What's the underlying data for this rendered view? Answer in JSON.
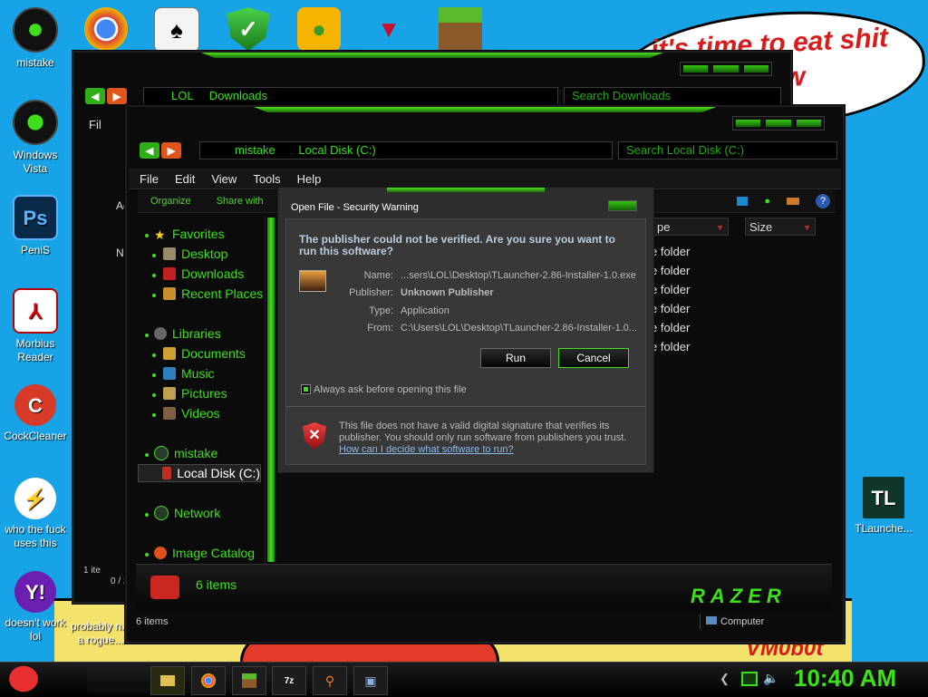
{
  "wallpaper": {
    "bubble_text": "it's time to eat shit chew",
    "signature": "VM0b0t"
  },
  "desktop_icons": [
    {
      "label": "mistake",
      "icon": "user-folder-icon"
    },
    {
      "label": "Windows Vista",
      "icon": "recycle-bin-icon"
    },
    {
      "label": "PeniS",
      "icon": "photoshop-icon",
      "glyph": "Ps"
    },
    {
      "label": "Morbius Reader",
      "icon": "pdf-reader-icon"
    },
    {
      "label": "CockCleaner",
      "icon": "ccleaner-icon",
      "glyph": "C"
    },
    {
      "label": "who the fuck uses this",
      "icon": "lightning-icon",
      "glyph": "⚡"
    },
    {
      "label": "doesn't work lol",
      "icon": "yahoo-messenger-icon",
      "glyph": "Y!"
    },
    {
      "label": "probably n... a rogue...",
      "icon": "rogue-app-icon"
    },
    {
      "label": "TLaunche...",
      "icon": "tlauncher-icon",
      "glyph": "TL"
    }
  ],
  "top_icons": [
    "chrome-icon",
    "solitaire-icon",
    "security-shield-icon",
    "angry-birds-pig-icon",
    "crest-icon",
    "minecraft-grass-icon"
  ],
  "back_window": {
    "breadcrumb": [
      "LOL",
      "Downloads"
    ],
    "search_placeholder": "Search Downloads",
    "menu_first": "Fil",
    "side_fragments": [
      "Ac",
      "Na"
    ],
    "status_fragment": "1 ite",
    "status_fragment2": "0 / 2"
  },
  "front_window": {
    "breadcrumb": [
      "mistake",
      "Local Disk (C:)"
    ],
    "search_placeholder": "Search Local Disk (C:)",
    "menu": [
      "File",
      "Edit",
      "View",
      "Tools",
      "Help"
    ],
    "toolbar": {
      "organize": "Organize",
      "share": "Share with"
    },
    "columns": {
      "type_fragment": "pe",
      "size": "Size"
    },
    "folder_type_fragment": "e folder",
    "folder_row_count": 6,
    "nav": {
      "favorites": "Favorites",
      "fav_items": [
        "Desktop",
        "Downloads",
        "Recent Places"
      ],
      "libraries": "Libraries",
      "lib_items": [
        "Documents",
        "Music",
        "Pictures",
        "Videos"
      ],
      "user": "mistake",
      "local_disk": "Local Disk (C:)",
      "network": "Network",
      "image_catalog": "Image Catalog"
    },
    "details_count": "6 items",
    "brand": "RAZER",
    "status_items": "6 items",
    "status_computer": "Computer"
  },
  "dialog": {
    "title": "Open File - Security Warning",
    "question": "The publisher could not be verified.  Are you sure you want to run this software?",
    "fields": [
      {
        "key": "Name:",
        "value": "...sers\\LOL\\Desktop\\TLauncher-2.86-Installer-1.0.exe"
      },
      {
        "key": "Publisher:",
        "value": "Unknown Publisher"
      },
      {
        "key": "Type:",
        "value": "Application"
      },
      {
        "key": "From:",
        "value": "C:\\Users\\LOL\\Desktop\\TLauncher-2.86-Installer-1.0..."
      }
    ],
    "run_label": "Run",
    "cancel_label": "Cancel",
    "checkbox_label": "Always ask before opening this file",
    "checkbox_checked": true,
    "warning_text": "This file does not have a valid digital signature that verifies its publisher.  You should only run software from publishers you trust.",
    "link": "How can I decide what software to run?"
  },
  "taskbar": {
    "start_icon": "angry-bird-start-icon",
    "pinned": [
      "explorer-icon",
      "chrome-icon",
      "minecraft-icon",
      "sevenzip-icon",
      "search-icon",
      "security-icon"
    ],
    "clock": "10:40 AM",
    "tray": [
      "back-arrow-icon",
      "network-icon",
      "volume-icon"
    ]
  },
  "colors": {
    "accent": "#3ee01c",
    "desktop": "#17a3e6",
    "window": "#0b0b0b"
  }
}
